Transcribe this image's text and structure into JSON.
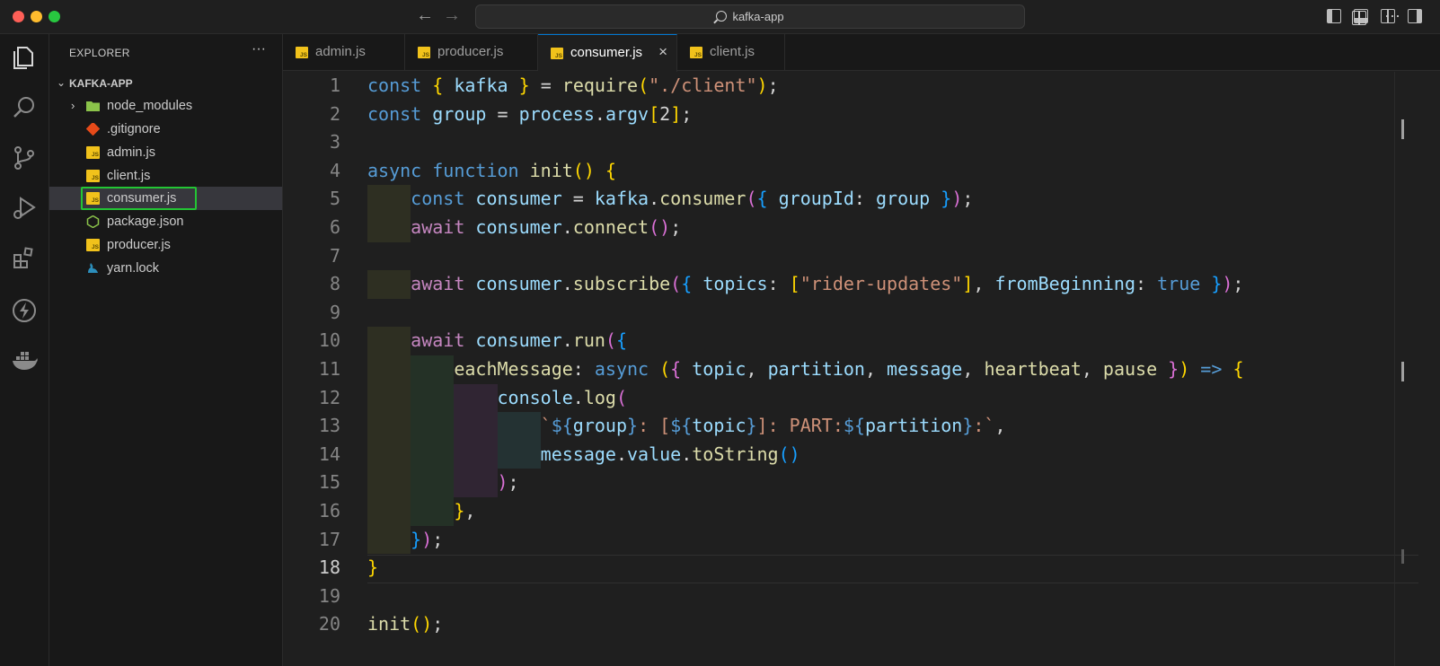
{
  "window": {
    "search_text": "kafka-app"
  },
  "explorer": {
    "title": "EXPLORER",
    "more": "···",
    "folder": "KAFKA-APP",
    "items": [
      {
        "label": "node_modules",
        "icon": "folder-icon"
      },
      {
        "label": ".gitignore",
        "icon": "git-icon"
      },
      {
        "label": "admin.js",
        "icon": "js-icon"
      },
      {
        "label": "client.js",
        "icon": "js-icon"
      },
      {
        "label": "consumer.js",
        "icon": "js-icon"
      },
      {
        "label": "package.json",
        "icon": "nodejs-icon"
      },
      {
        "label": "producer.js",
        "icon": "js-icon"
      },
      {
        "label": "yarn.lock",
        "icon": "yarn-icon"
      }
    ]
  },
  "tabs": [
    {
      "label": "admin.js"
    },
    {
      "label": "producer.js"
    },
    {
      "label": "consumer.js",
      "close": "×"
    },
    {
      "label": "client.js"
    }
  ],
  "tab_more": "···",
  "js_badge": "JS",
  "colors": {
    "selection_outline": "#23c534",
    "keyword": "#569cd6",
    "control": "#c586c0",
    "variable": "#9cdcfe",
    "function": "#dcdcaa",
    "string": "#ce9178"
  },
  "editor": {
    "line_numbers": [
      "1",
      "2",
      "3",
      "4",
      "5",
      "6",
      "7",
      "8",
      "9",
      "10",
      "11",
      "12",
      "13",
      "14",
      "15",
      "16",
      "17",
      "18",
      "19",
      "20"
    ],
    "current_line": "18",
    "lines": [
      [
        [
          "kw",
          "const "
        ],
        [
          "b1",
          "{ "
        ],
        [
          "var",
          "kafka"
        ],
        [
          "b1",
          " }"
        ],
        [
          "pl",
          " = "
        ],
        [
          "fn",
          "require"
        ],
        [
          "b1",
          "("
        ],
        [
          "str",
          "\"./client\""
        ],
        [
          "b1",
          ")"
        ],
        [
          "pl",
          ";"
        ]
      ],
      [
        [
          "kw",
          "const "
        ],
        [
          "var",
          "group"
        ],
        [
          "pl",
          " = "
        ],
        [
          "var",
          "process"
        ],
        [
          "pl",
          "."
        ],
        [
          "var",
          "argv"
        ],
        [
          "b1",
          "["
        ],
        [
          "pl",
          "2"
        ],
        [
          "b1",
          "]"
        ],
        [
          "pl",
          ";"
        ]
      ],
      [],
      [
        [
          "kw",
          "async function "
        ],
        [
          "fn",
          "init"
        ],
        [
          "b1",
          "() {"
        ]
      ],
      [
        [
          "pl",
          "    "
        ],
        [
          "kw",
          "const "
        ],
        [
          "var",
          "consumer"
        ],
        [
          "pl",
          " = "
        ],
        [
          "var",
          "kafka"
        ],
        [
          "pl",
          "."
        ],
        [
          "fn",
          "consumer"
        ],
        [
          "b2",
          "("
        ],
        [
          "b3",
          "{ "
        ],
        [
          "var",
          "groupId"
        ],
        [
          "pl",
          ": "
        ],
        [
          "var",
          "group"
        ],
        [
          "b3",
          " }"
        ],
        [
          "b2",
          ")"
        ],
        [
          "pl",
          ";"
        ]
      ],
      [
        [
          "pl",
          "    "
        ],
        [
          "ctl",
          "await "
        ],
        [
          "var",
          "consumer"
        ],
        [
          "pl",
          "."
        ],
        [
          "fn",
          "connect"
        ],
        [
          "b2",
          "()"
        ],
        [
          "pl",
          ";"
        ]
      ],
      [],
      [
        [
          "pl",
          "    "
        ],
        [
          "ctl",
          "await "
        ],
        [
          "var",
          "consumer"
        ],
        [
          "pl",
          "."
        ],
        [
          "fn",
          "subscribe"
        ],
        [
          "b2",
          "("
        ],
        [
          "b3",
          "{ "
        ],
        [
          "var",
          "topics"
        ],
        [
          "pl",
          ": "
        ],
        [
          "b1",
          "["
        ],
        [
          "str",
          "\"rider-updates\""
        ],
        [
          "b1",
          "]"
        ],
        [
          "pl",
          ", "
        ],
        [
          "var",
          "fromBeginning"
        ],
        [
          "pl",
          ": "
        ],
        [
          "kw",
          "true"
        ],
        [
          "b3",
          " }"
        ],
        [
          "b2",
          ")"
        ],
        [
          "pl",
          ";"
        ]
      ],
      [],
      [
        [
          "pl",
          "    "
        ],
        [
          "ctl",
          "await "
        ],
        [
          "var",
          "consumer"
        ],
        [
          "pl",
          "."
        ],
        [
          "fn",
          "run"
        ],
        [
          "b2",
          "("
        ],
        [
          "b3",
          "{"
        ]
      ],
      [
        [
          "pl",
          "        "
        ],
        [
          "fn",
          "eachMessage"
        ],
        [
          "pl",
          ": "
        ],
        [
          "kw",
          "async "
        ],
        [
          "b1",
          "("
        ],
        [
          "b2",
          "{ "
        ],
        [
          "var",
          "topic"
        ],
        [
          "pl",
          ", "
        ],
        [
          "var",
          "partition"
        ],
        [
          "pl",
          ", "
        ],
        [
          "var",
          "message"
        ],
        [
          "pl",
          ", "
        ],
        [
          "fn",
          "heartbeat"
        ],
        [
          "pl",
          ", "
        ],
        [
          "fn",
          "pause"
        ],
        [
          "b2",
          " }"
        ],
        [
          "b1",
          ")"
        ],
        [
          "kw",
          " => "
        ],
        [
          "b1",
          "{"
        ]
      ],
      [
        [
          "pl",
          "            "
        ],
        [
          "var",
          "console"
        ],
        [
          "pl",
          "."
        ],
        [
          "fn",
          "log"
        ],
        [
          "b2",
          "("
        ]
      ],
      [
        [
          "pl",
          "                "
        ],
        [
          "str",
          "`"
        ],
        [
          "kw",
          "${"
        ],
        [
          "var",
          "group"
        ],
        [
          "kw",
          "}"
        ],
        [
          "str",
          ": ["
        ],
        [
          "kw",
          "${"
        ],
        [
          "var",
          "topic"
        ],
        [
          "kw",
          "}"
        ],
        [
          "str",
          "]: PART:"
        ],
        [
          "kw",
          "${"
        ],
        [
          "var",
          "partition"
        ],
        [
          "kw",
          "}"
        ],
        [
          "str",
          ":`"
        ],
        [
          "pl",
          ","
        ]
      ],
      [
        [
          "pl",
          "                "
        ],
        [
          "var",
          "message"
        ],
        [
          "pl",
          "."
        ],
        [
          "var",
          "value"
        ],
        [
          "pl",
          "."
        ],
        [
          "fn",
          "toString"
        ],
        [
          "b3",
          "()"
        ]
      ],
      [
        [
          "pl",
          "            "
        ],
        [
          "b2",
          ")"
        ],
        [
          "pl",
          ";"
        ]
      ],
      [
        [
          "pl",
          "        "
        ],
        [
          "b1",
          "}"
        ],
        [
          "pl",
          ","
        ]
      ],
      [
        [
          "pl",
          "    "
        ],
        [
          "b3",
          "}"
        ],
        [
          "b2",
          ")"
        ],
        [
          "pl",
          ";"
        ]
      ],
      [
        [
          "b1",
          "}"
        ]
      ],
      [],
      [
        [
          "fn",
          "init"
        ],
        [
          "b1",
          "()"
        ],
        [
          "pl",
          ";"
        ]
      ]
    ]
  }
}
